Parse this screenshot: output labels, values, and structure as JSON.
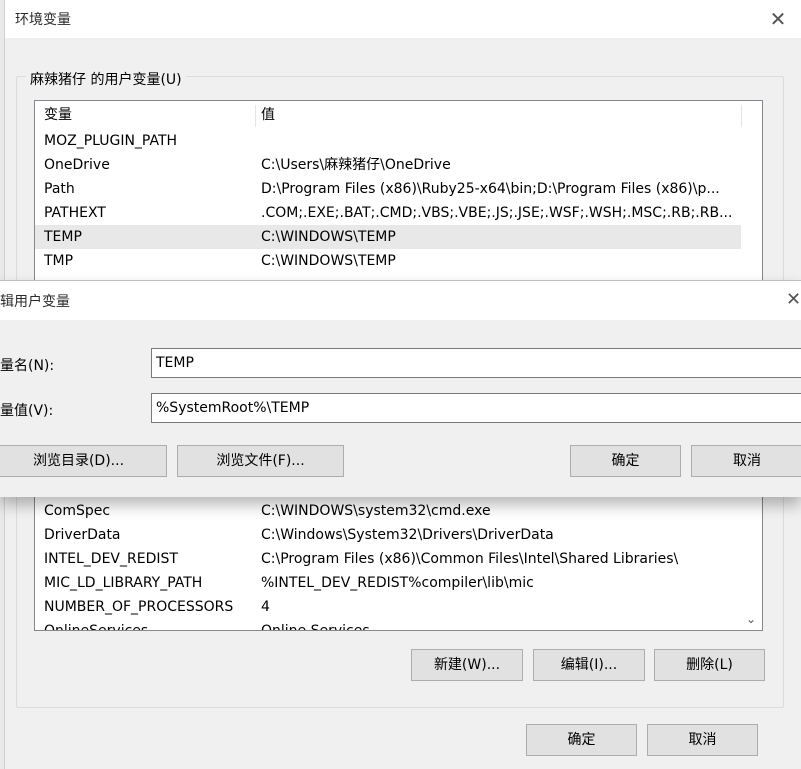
{
  "main_window": {
    "title": "环境变量",
    "close_glyph": "✕",
    "user_group_label": "麻辣猪仔 的用户变量(U)",
    "user_table": {
      "headers": [
        "变量",
        "值"
      ],
      "rows": [
        {
          "name": "MOZ_PLUGIN_PATH",
          "value": ""
        },
        {
          "name": "OneDrive",
          "value": "C:\\Users\\麻辣猪仔\\OneDrive"
        },
        {
          "name": "Path",
          "value": "D:\\Program Files (x86)\\Ruby25-x64\\bin;D:\\Program Files (x86)\\p..."
        },
        {
          "name": "PATHEXT",
          "value": ".COM;.EXE;.BAT;.CMD;.VBS;.VBE;.JS;.JSE;.WSF;.WSH;.MSC;.RB;.RB..."
        },
        {
          "name": "TEMP",
          "value": "C:\\WINDOWS\\TEMP"
        },
        {
          "name": "TMP",
          "value": "C:\\WINDOWS\\TEMP"
        }
      ]
    },
    "system_table": {
      "rows": [
        {
          "name": "ComSpec",
          "value": "C:\\WINDOWS\\system32\\cmd.exe"
        },
        {
          "name": "DriverData",
          "value": "C:\\Windows\\System32\\Drivers\\DriverData"
        },
        {
          "name": "INTEL_DEV_REDIST",
          "value": "C:\\Program Files (x86)\\Common Files\\Intel\\Shared Libraries\\"
        },
        {
          "name": "MIC_LD_LIBRARY_PATH",
          "value": "%INTEL_DEV_REDIST%compiler\\lib\\mic"
        },
        {
          "name": "NUMBER_OF_PROCESSORS",
          "value": "4"
        },
        {
          "name": "OnlineServices",
          "value": "Online Services"
        }
      ],
      "scroll_down_glyph": "⌄"
    },
    "buttons": {
      "new": "新建(W)...",
      "edit": "编辑(I)...",
      "delete": "删除(L)",
      "ok": "确定",
      "cancel": "取消"
    }
  },
  "edit_dialog": {
    "title": "编辑用户变量",
    "close_glyph": "✕",
    "name_label": "变量名(N):",
    "name_value": "TEMP",
    "value_label": "变量值(V):",
    "value_value": "%SystemRoot%\\TEMP",
    "buttons": {
      "browse_dir": "浏览目录(D)...",
      "browse_file": "浏览文件(F)...",
      "ok": "确定",
      "cancel": "取消"
    }
  },
  "colors": {
    "selected_row": "#e8e8e8",
    "dialog_bg": "#f0f0f0",
    "titlebar_bg": "#ffffff"
  }
}
